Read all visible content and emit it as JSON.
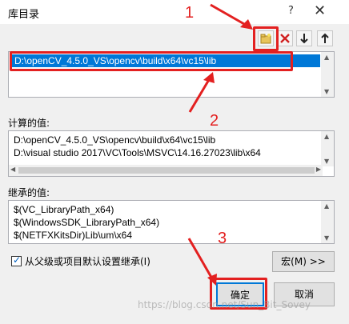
{
  "window": {
    "title": "库目录",
    "help_label": "?",
    "close_label": "✕"
  },
  "toolbar": {
    "new_folder_icon": "new-folder-icon",
    "delete_icon": "delete-x-icon",
    "move_down_icon": "arrow-down-icon",
    "move_up_icon": "arrow-up-icon"
  },
  "main_list": {
    "items": [
      "D:\\openCV_4.5.0_VS\\opencv\\build\\x64\\vc15\\lib"
    ]
  },
  "computed": {
    "label": "计算的值:",
    "items": [
      "D:\\openCV_4.5.0_VS\\opencv\\build\\x64\\vc15\\lib",
      "D:\\visual studio 2017\\VC\\Tools\\MSVC\\14.16.27023\\lib\\x64"
    ]
  },
  "inherited": {
    "label": "继承的值:",
    "items": [
      "$(VC_LibraryPath_x64)",
      "$(WindowsSDK_LibraryPath_x64)",
      "$(NETFXKitsDir)Lib\\um\\x64"
    ]
  },
  "inherit_checkbox": {
    "label": "从父级或项目默认设置继承(I)",
    "checked": true
  },
  "buttons": {
    "macro": "宏(M) >>",
    "ok": "确定",
    "cancel": "取消"
  },
  "annotations": {
    "num1": "1",
    "num2": "2",
    "num3": "3",
    "color": "#e32020"
  },
  "watermark": "https://blog.csdn.net/Sun_Bit_Sovey"
}
